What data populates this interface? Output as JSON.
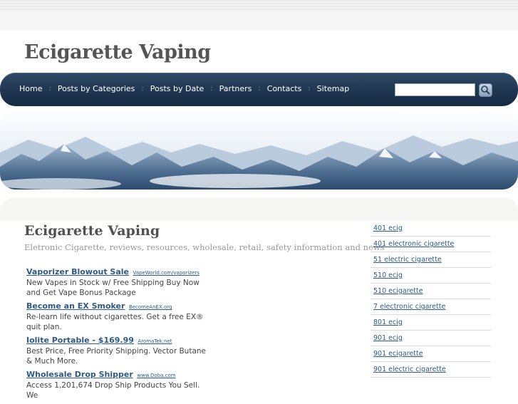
{
  "header": {
    "site_title": "Ecigarette Vaping"
  },
  "nav": {
    "items": [
      {
        "label": "Home"
      },
      {
        "label": "Posts by Categories"
      },
      {
        "label": "Posts by Date"
      },
      {
        "label": "Partners"
      },
      {
        "label": "Contacts"
      },
      {
        "label": "Sitemap"
      }
    ],
    "separator": ":",
    "search": {
      "value": "",
      "placeholder": ""
    }
  },
  "banner": {
    "description": "snowy mountain range image"
  },
  "main": {
    "title": "Ecigarette Vaping",
    "description": "Eletronic Cigarette, reviews, resources, wholesale, retail, safety information and news",
    "ads": [
      {
        "title": "Vaporizer Blowout Sale",
        "url": "VapeWorld.com/vaporizers",
        "text": "New Vapes in Stock w/ Free Shipping Buy Now and Get Vape Bonus Package"
      },
      {
        "title": "Become an EX Smoker",
        "url": "BecomeAnEX.org",
        "text": "Re-learn life without cigarettes. Get a free EX® quit plan."
      },
      {
        "title": "Iolite Portable - $169.99",
        "url": "AromaTek.net",
        "text": "Best Price, Free Priority Shipping. Vector Butane & Much More."
      },
      {
        "title": "Wholesale Drop Shipper",
        "url": "www.Doba.com",
        "text": "Access 1,201,674 Drop Ship Products You Sell. We"
      }
    ]
  },
  "sidebar": {
    "links": [
      {
        "label": "401 ecig"
      },
      {
        "label": "401 electronic cigarette"
      },
      {
        "label": "51 electric cigarette"
      },
      {
        "label": "510 ecig"
      },
      {
        "label": "510 ecigarette"
      },
      {
        "label": "7 electronic cigarette"
      },
      {
        "label": "801 ecig"
      },
      {
        "label": "901 ecig"
      },
      {
        "label": "901 ecigarette"
      },
      {
        "label": "901 electric cigarette"
      }
    ]
  },
  "colors": {
    "nav_bg": "#1f3550",
    "link": "#2b5a8a",
    "title": "#555555"
  }
}
